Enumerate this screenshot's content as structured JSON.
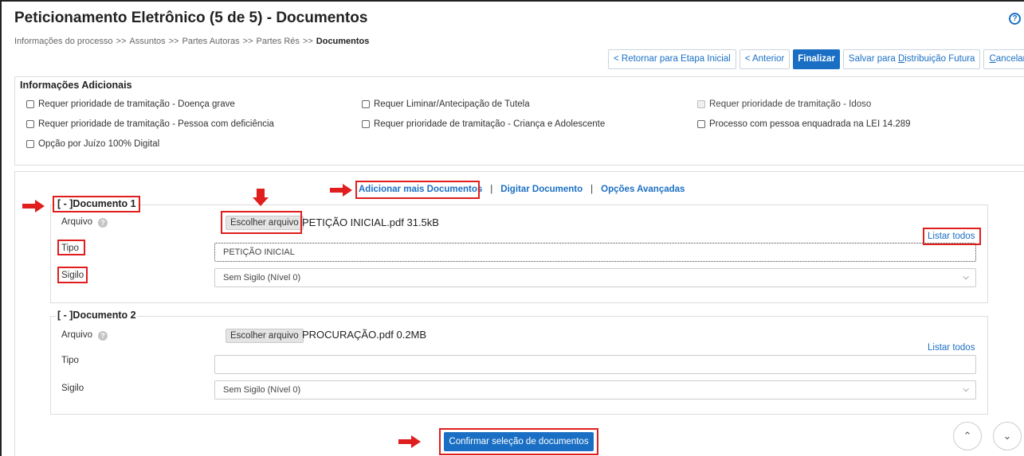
{
  "header": {
    "title": "Peticionamento Eletrônico (5 de 5) - Documentos",
    "help_icon": "?",
    "breadcrumb": [
      "Informações do processo",
      "Assuntos",
      "Partes Autoras",
      "Partes Rés",
      "Documentos"
    ],
    "breadcrumb_sep": ">>"
  },
  "actions": {
    "return_initial": "< Retornar para Etapa Inicial",
    "previous": "< Anterior",
    "finish": "Finalizar",
    "save_future_pre": "Salvar para ",
    "save_future_letter": "D",
    "save_future_post": "istribuição Futura",
    "cancel_letter": "C",
    "cancel_post": "ancelar"
  },
  "info": {
    "legend": "Informações Adicionais",
    "options": [
      {
        "label": "Requer prioridade de tramitação - Doença grave",
        "checked": false,
        "disabled": false
      },
      {
        "label": "Requer Liminar/Antecipação de Tutela",
        "checked": false,
        "disabled": false
      },
      {
        "label": "Requer prioridade de tramitação - Idoso",
        "checked": false,
        "disabled": true
      },
      {
        "label": "Requer prioridade de tramitação - Pessoa com deficiência",
        "checked": false,
        "disabled": false
      },
      {
        "label": "Requer prioridade de tramitação - Criança e Adolescente",
        "checked": false,
        "disabled": false
      },
      {
        "label": "Processo com pessoa enquadrada na LEI 14.289",
        "checked": false,
        "disabled": false
      },
      {
        "label": "Opção por Juízo 100% Digital",
        "checked": false,
        "disabled": false
      }
    ]
  },
  "doc_links": {
    "add_more": "Adicionar mais Documentos",
    "type_doc": "Digitar Documento",
    "advanced": "Opções Avançadas",
    "pipe": "|"
  },
  "documents": [
    {
      "legend": "[ - ]Documento 1",
      "file_label": "Arquivo",
      "choose_file": "Escolher arquivo",
      "file_name": "PETIÇÃO INICIAL.pdf 31.5kB",
      "list_all": "Listar todos",
      "type_label": "Tipo",
      "type_value": "PETIÇÃO INICIAL",
      "secrecy_label": "Sigilo",
      "secrecy_value": "Sem Sigilo (Nível 0)"
    },
    {
      "legend": "[ - ]Documento 2",
      "file_label": "Arquivo",
      "choose_file": "Escolher arquivo",
      "file_name": "PROCURAÇÃO.pdf 0.2MB",
      "list_all": "Listar todos",
      "type_label": "Tipo",
      "type_value": "",
      "secrecy_label": "Sigilo",
      "secrecy_value": "Sem Sigilo (Nível 0)"
    }
  ],
  "confirm_button": "Confirmar seleção de documentos",
  "scroll": {
    "up": "⌃",
    "down": "⌄"
  },
  "colors": {
    "accent": "#1a6fc4",
    "highlight": "#e01e1e"
  }
}
